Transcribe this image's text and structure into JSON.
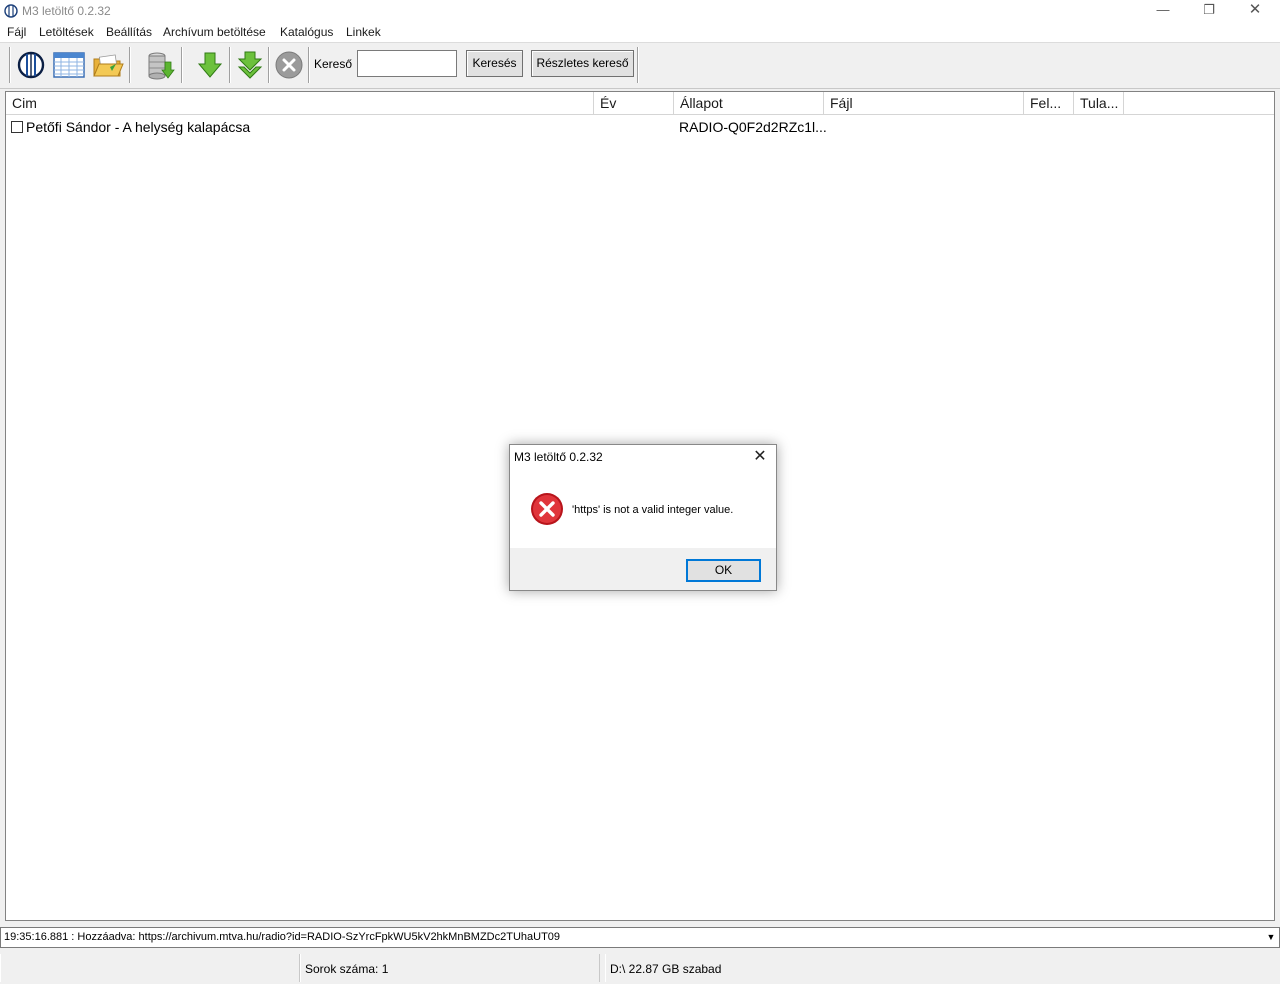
{
  "window": {
    "title": "M3 letöltő 0.2.32",
    "minimize": "—",
    "maximize": "❐",
    "close": "✕"
  },
  "menu": {
    "items": [
      "Fájl",
      "Letöltések",
      "Beállítás",
      "Archívum betöltése",
      "Katalógus",
      "Linkek"
    ]
  },
  "toolbar": {
    "buttons": [
      {
        "icon": "m3-logo-icon"
      },
      {
        "icon": "table-grid-icon"
      },
      {
        "icon": "open-folder-icon"
      },
      {
        "icon": "database-download-icon"
      },
      {
        "icon": "download-arrow-icon"
      },
      {
        "icon": "download-all-arrow-icon"
      },
      {
        "icon": "cancel-icon"
      }
    ],
    "search_label": "Kereső",
    "search_value": "",
    "search_button": "Keresés",
    "advanced_button": "Részletes kereső"
  },
  "list": {
    "columns": [
      "Cim",
      "Év",
      "Állapot",
      "Fájl",
      "Fel...",
      "Tula..."
    ],
    "rows": [
      {
        "checked": false,
        "title": "Petőfi Sándor - A helység kalapácsa",
        "year": "",
        "status": "RADIO-Q0F2d2RZc1l...",
        "file": "",
        "fel": "",
        "tula": ""
      }
    ]
  },
  "log": {
    "text": "19:35:16.881 : Hozzáadva: https://archivum.mtva.hu/radio?id=RADIO-SzYrcFpkWU5kV2hkMnBMZDc2TUhaUT09"
  },
  "status": {
    "panel1": "",
    "panel2": "Sorok száma: 1",
    "panel3": "D:\\  22.87 GB szabad"
  },
  "dialog": {
    "title": "M3 letöltő 0.2.32",
    "icon": "error-icon",
    "message": "'https' is not a valid integer value.",
    "ok_label": "OK",
    "close": "✕"
  },
  "colors": {
    "error_red": "#d9252b",
    "arrow_green": "#5cb531",
    "accent_blue": "#0078d7"
  }
}
